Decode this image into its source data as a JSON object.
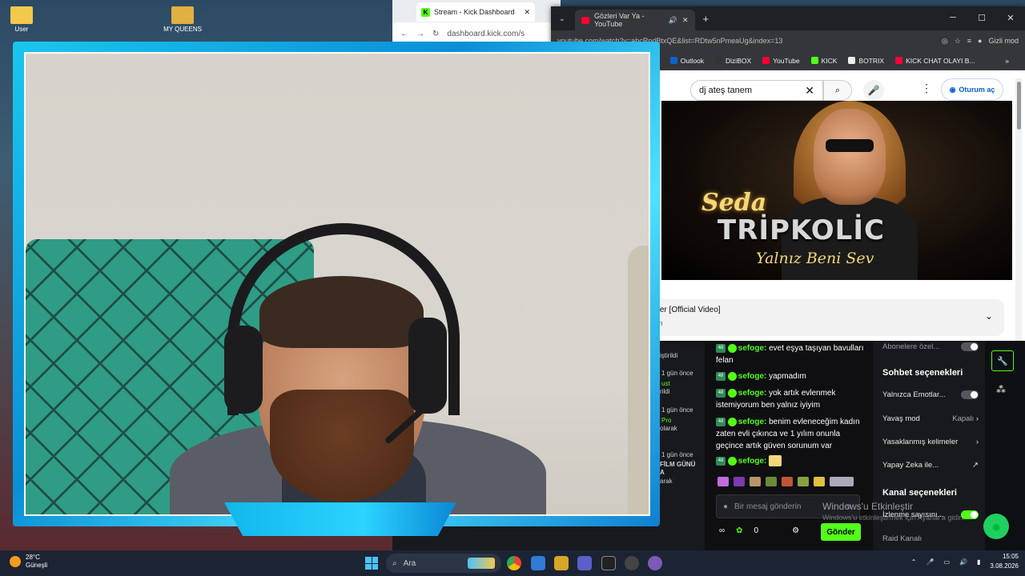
{
  "desktop": {
    "icon1": "User",
    "icon2": "MY QUEENS"
  },
  "kick_window": {
    "tab_title": "Stream - Kick Dashboard",
    "url": "dashboard.kick.com/s",
    "side_texts": [
      "iştirildi",
      "1 gün önce",
      "ust",
      "rildi",
      "1 gün önce",
      "Pro",
      "olarak",
      "1 gün önce",
      "FİLM GÜNÜ",
      "A",
      "arak"
    ]
  },
  "youtube": {
    "tab_title": "Gözleri Var Ya - YouTube",
    "url": "youtube.com/watch?v=abcRndBtxQE&list=RDtw5nPmeaUg&index=13",
    "incognito": "Gizli mod",
    "bookmarks": [
      "Outlook",
      "DiziBOX",
      "YouTube",
      "KICK",
      "BOTRIX",
      "KICK CHAT OLAYI B..."
    ],
    "bookmark_partial": "L",
    "search_value": "dj ateş tanem",
    "signin": "Oturum aç",
    "thumb_text1": "Seda",
    "thumb_text2": "TRİPKOLİC",
    "thumb_text3": "Yalnız Beni Sev",
    "desc_title": "nmer [Official Video]",
    "desc_sub": "nem"
  },
  "chat": {
    "messages": [
      {
        "user": "sefoge:",
        "text": "evet eşya taşıyan bavulları felan"
      },
      {
        "user": "sefoge:",
        "text": "yapmadım"
      },
      {
        "user": "sefoge:",
        "text": "yok artık evlenmek istemiyorum ben yalnız iyiyim"
      },
      {
        "user": "sefoge:",
        "text": "benim evleneceğim kadın zaten evli çıkınca ve 1 yılım onunla geçince artık güven sorunum var"
      },
      {
        "user": "sefoge:",
        "text": ""
      }
    ],
    "badge": "48",
    "placeholder": "Bir mesaj gönderin",
    "points": "0",
    "send": "Gönder"
  },
  "settings": {
    "top_label": "Abonelere özel...",
    "section1": "Sohbet seçenekleri",
    "emote_only": "Yalnızca Emotlar...",
    "slow_mode": "Yavaş mod",
    "slow_value": "Kapalı",
    "banned_words": "Yasaklanmış kelimeler",
    "ai": "Yapay Zeka ile...",
    "section2": "Kanal seçenekleri",
    "views": "İzlenme sayısını...",
    "raid": "Raid Kanalı"
  },
  "watermark": {
    "line1": "Windows'u Etkinleştir",
    "line2": "Windows'u etkinleştirmek için Ayarlar'a gidin."
  },
  "taskbar": {
    "temp": "28°C",
    "weather": "Güneşli",
    "search": "Ara",
    "time": "15:05",
    "date": "3.08.2026"
  },
  "colors": {
    "kick_green": "#53fc18",
    "cam_frame": "#19c7ef"
  }
}
